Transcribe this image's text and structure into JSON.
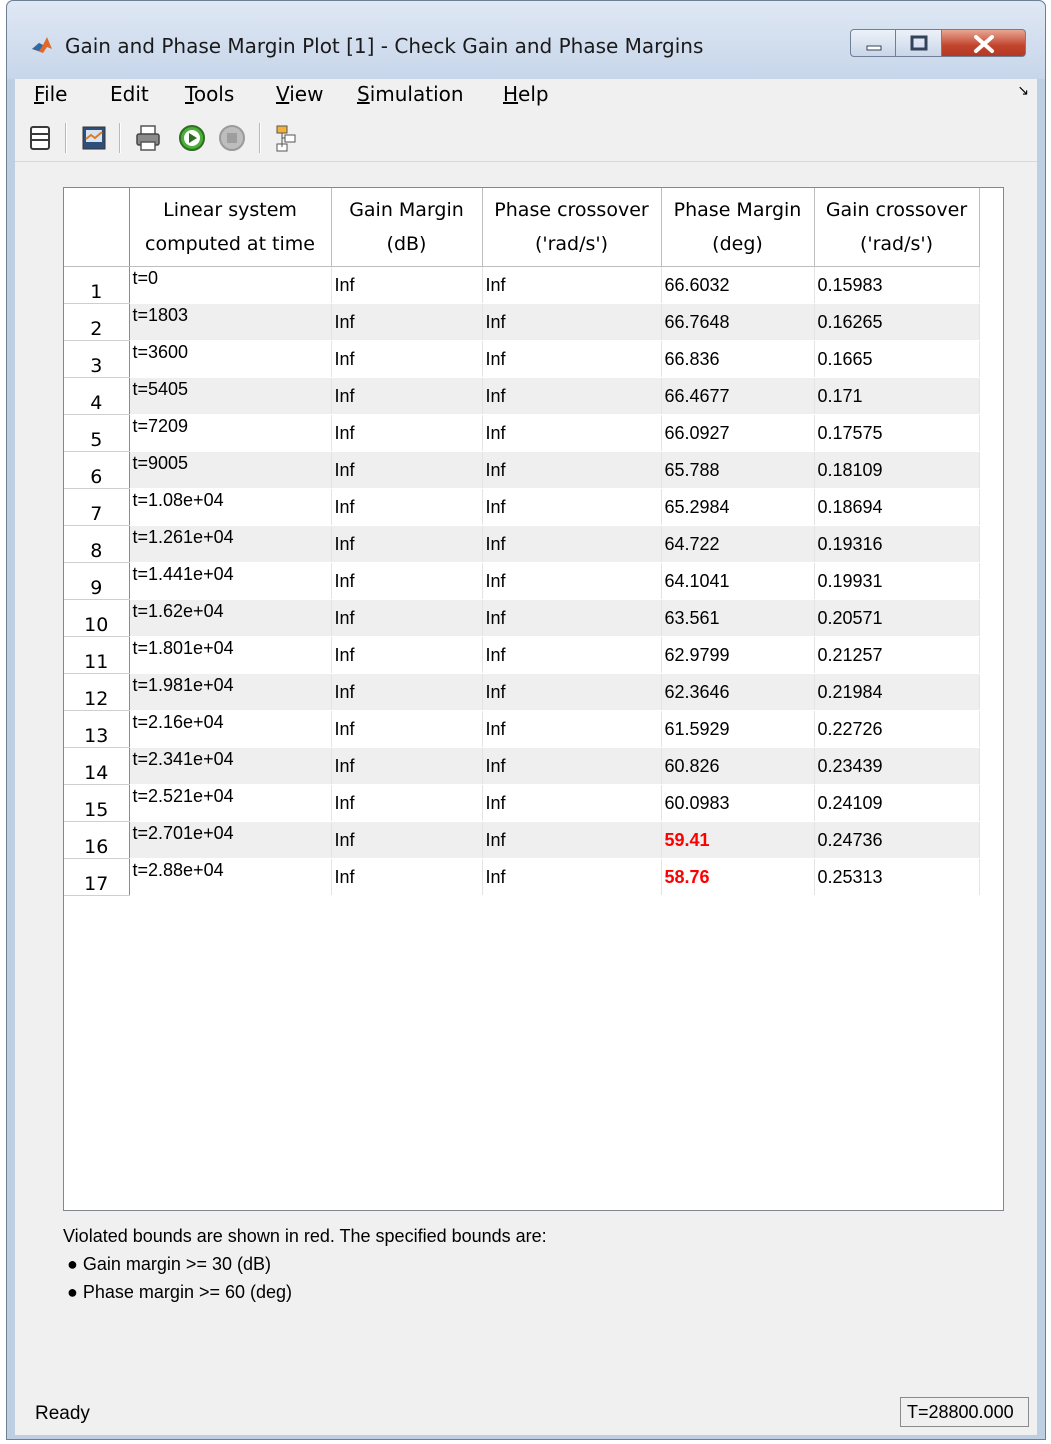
{
  "window": {
    "title": "Gain and Phase Margin Plot [1] - Check Gain and Phase Margins"
  },
  "menu": [
    {
      "label": "File",
      "mnemonic": "F",
      "rest": "ile"
    },
    {
      "label": "Edit",
      "mnemonic": "",
      "rest": "Edit"
    },
    {
      "label": "Tools",
      "mnemonic": "T",
      "rest": "ools"
    },
    {
      "label": "View",
      "mnemonic": "V",
      "rest": "iew"
    },
    {
      "label": "Simulation",
      "mnemonic": "S",
      "rest": "imulation"
    },
    {
      "label": "Help",
      "mnemonic": "H",
      "rest": "elp"
    }
  ],
  "toolbar": {
    "icons": [
      "table-view-icon",
      "plot-view-icon",
      "print-icon",
      "run-simulation-icon",
      "stop-simulation-icon",
      "highlight-block-icon"
    ]
  },
  "table": {
    "headers": [
      {
        "line1": "",
        "line2": ""
      },
      {
        "line1": "Linear system",
        "line2": "computed at time"
      },
      {
        "line1": "Gain Margin",
        "line2": "(dB)"
      },
      {
        "line1": "Phase crossover",
        "line2": "('rad/s')"
      },
      {
        "line1": "Phase Margin",
        "line2": "(deg)"
      },
      {
        "line1": "Gain crossover",
        "line2": "('rad/s')"
      }
    ],
    "rows": [
      {
        "num": "1",
        "time": "t=0",
        "gm": "Inf",
        "pc": "Inf",
        "pm": "66.6032",
        "gc": "0.15983",
        "violated": false
      },
      {
        "num": "2",
        "time": "t=1803",
        "gm": "Inf",
        "pc": "Inf",
        "pm": "66.7648",
        "gc": "0.16265",
        "violated": false
      },
      {
        "num": "3",
        "time": "t=3600",
        "gm": "Inf",
        "pc": "Inf",
        "pm": "66.836",
        "gc": "0.1665",
        "violated": false
      },
      {
        "num": "4",
        "time": "t=5405",
        "gm": "Inf",
        "pc": "Inf",
        "pm": "66.4677",
        "gc": "0.171",
        "violated": false
      },
      {
        "num": "5",
        "time": "t=7209",
        "gm": "Inf",
        "pc": "Inf",
        "pm": "66.0927",
        "gc": "0.17575",
        "violated": false
      },
      {
        "num": "6",
        "time": "t=9005",
        "gm": "Inf",
        "pc": "Inf",
        "pm": "65.788",
        "gc": "0.18109",
        "violated": false
      },
      {
        "num": "7",
        "time": "t=1.08e+04",
        "gm": "Inf",
        "pc": "Inf",
        "pm": "65.2984",
        "gc": "0.18694",
        "violated": false
      },
      {
        "num": "8",
        "time": "t=1.261e+04",
        "gm": "Inf",
        "pc": "Inf",
        "pm": "64.722",
        "gc": "0.19316",
        "violated": false
      },
      {
        "num": "9",
        "time": "t=1.441e+04",
        "gm": "Inf",
        "pc": "Inf",
        "pm": "64.1041",
        "gc": "0.19931",
        "violated": false
      },
      {
        "num": "10",
        "time": "t=1.62e+04",
        "gm": "Inf",
        "pc": "Inf",
        "pm": "63.561",
        "gc": "0.20571",
        "violated": false
      },
      {
        "num": "11",
        "time": "t=1.801e+04",
        "gm": "Inf",
        "pc": "Inf",
        "pm": "62.9799",
        "gc": "0.21257",
        "violated": false
      },
      {
        "num": "12",
        "time": "t=1.981e+04",
        "gm": "Inf",
        "pc": "Inf",
        "pm": "62.3646",
        "gc": "0.21984",
        "violated": false
      },
      {
        "num": "13",
        "time": "t=2.16e+04",
        "gm": "Inf",
        "pc": "Inf",
        "pm": "61.5929",
        "gc": "0.22726",
        "violated": false
      },
      {
        "num": "14",
        "time": "t=2.341e+04",
        "gm": "Inf",
        "pc": "Inf",
        "pm": "60.826",
        "gc": "0.23439",
        "violated": false
      },
      {
        "num": "15",
        "time": "t=2.521e+04",
        "gm": "Inf",
        "pc": "Inf",
        "pm": "60.0983",
        "gc": "0.24109",
        "violated": false
      },
      {
        "num": "16",
        "time": "t=2.701e+04",
        "gm": "Inf",
        "pc": "Inf",
        "pm": "59.41",
        "gc": "0.24736",
        "violated": true
      },
      {
        "num": "17",
        "time": "t=2.88e+04",
        "gm": "Inf",
        "pc": "Inf",
        "pm": "58.76",
        "gc": "0.25313",
        "violated": true
      }
    ]
  },
  "notes": {
    "intro": "Violated bounds are shown in red. The specified bounds are:",
    "bullets": [
      "Gain margin >= 30 (dB)",
      "Phase margin >= 60 (deg)"
    ]
  },
  "status": {
    "text": "Ready",
    "time": "T=28800.000"
  },
  "colors": {
    "violation": "#ff0000",
    "window_frame": "#bfcfe3",
    "close_button": "#c2452e"
  }
}
